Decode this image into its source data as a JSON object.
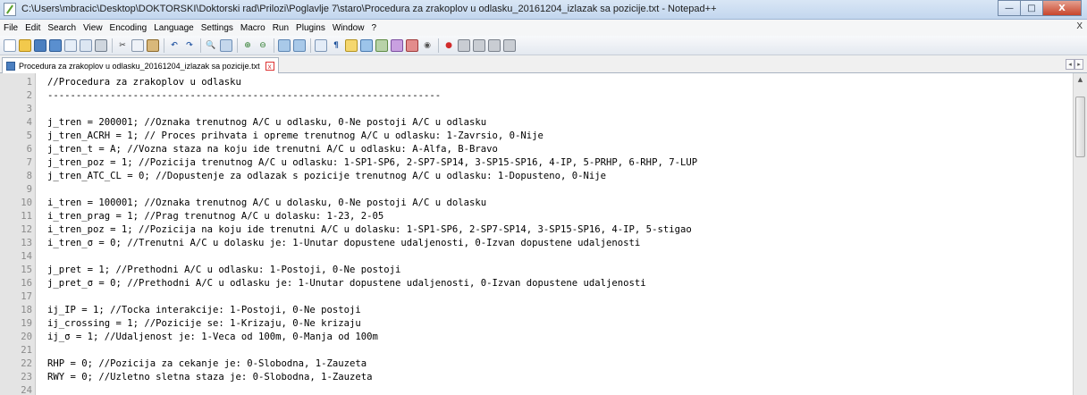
{
  "window": {
    "title": "C:\\Users\\mbracic\\Desktop\\DOKTORSKI\\Doktorski rad\\Prilozi\\Poglavlje 7\\staro\\Procedura za zrakoplov u odlasku_20161204_izlazak sa pozicije.txt - Notepad++",
    "minimize": "—",
    "maximize": "□",
    "close": "X"
  },
  "menu": {
    "items": [
      "File",
      "Edit",
      "Search",
      "View",
      "Encoding",
      "Language",
      "Settings",
      "Macro",
      "Run",
      "Plugins",
      "Window",
      "?"
    ],
    "close_doc": "X"
  },
  "toolbar": {
    "icons": [
      "new-file-icon",
      "open-icon",
      "save-icon",
      "save-all-icon",
      "close-icon",
      "close-all-icon",
      "print-icon",
      "cut-icon",
      "copy-icon",
      "paste-icon",
      "undo-icon",
      "redo-icon",
      "find-icon",
      "replace-icon",
      "zoom-in-icon",
      "zoom-out-icon",
      "sync-v-icon",
      "sync-h-icon",
      "word-wrap-icon",
      "show-all-icon",
      "indent-guide-icon",
      "doc-map-icon",
      "function-list-icon",
      "folder-workspace-icon",
      "monitor-icon",
      "record-macro-icon",
      "stop-macro-icon",
      "play-macro-icon",
      "play-multi-icon",
      "save-macro-icon"
    ]
  },
  "tab": {
    "label": "Procedura za zrakoplov u odlasku_20161204_izlazak sa pozicije.txt",
    "close": "x"
  },
  "editor": {
    "lines": [
      {
        "n": "1",
        "text": "//Procedura za zrakoplov u odlasku"
      },
      {
        "n": "2",
        "text": "---------------------------------------------------------------------"
      },
      {
        "n": "3",
        "text": ""
      },
      {
        "n": "4",
        "text": "j_tren = 200001; //Oznaka trenutnog A/C u odlasku, 0-Ne postoji A/C u odlasku"
      },
      {
        "n": "5",
        "text": "j_tren_ACRH = 1; // Proces prihvata i opreme trenutnog A/C u odlasku: 1-Zavrsio, 0-Nije"
      },
      {
        "n": "6",
        "text": "j_tren_t = A; //Vozna staza na koju ide trenutni A/C u odlasku: A-Alfa, B-Bravo"
      },
      {
        "n": "7",
        "text": "j_tren_poz = 1; //Pozicija trenutnog A/C u odlasku: 1-SP1-SP6, 2-SP7-SP14, 3-SP15-SP16, 4-IP, 5-PRHP, 6-RHP, 7-LUP"
      },
      {
        "n": "8",
        "text": "j_tren_ATC_CL = 0; //Dopustenje za odlazak s pozicije trenutnog A/C u odlasku: 1-Dopusteno, 0-Nije"
      },
      {
        "n": "9",
        "text": ""
      },
      {
        "n": "10",
        "text": "i_tren = 100001; //Oznaka trenutnog A/C u dolasku, 0-Ne postoji A/C u dolasku"
      },
      {
        "n": "11",
        "text": "i_tren_prag = 1; //Prag trenutnog A/C u dolasku: 1-23, 2-05"
      },
      {
        "n": "12",
        "text": "i_tren_poz = 1; //Pozicija na koju ide trenutni A/C u dolasku: 1-SP1-SP6, 2-SP7-SP14, 3-SP15-SP16, 4-IP, 5-stigao"
      },
      {
        "n": "13",
        "text": "i_tren_σ = 0; //Trenutni A/C u dolasku je: 1-Unutar dopustene udaljenosti, 0-Izvan dopustene udaljenosti"
      },
      {
        "n": "14",
        "text": ""
      },
      {
        "n": "15",
        "text": "j_pret = 1; //Prethodni A/C u odlasku: 1-Postoji, 0-Ne postoji"
      },
      {
        "n": "16",
        "text": "j_pret_σ = 0; //Prethodni A/C u odlasku je: 1-Unutar dopustene udaljenosti, 0-Izvan dopustene udaljenosti"
      },
      {
        "n": "17",
        "text": ""
      },
      {
        "n": "18",
        "text": "ij_IP = 1; //Tocka interakcije: 1-Postoji, 0-Ne postoji"
      },
      {
        "n": "19",
        "text": "ij_crossing = 1; //Pozicije se: 1-Krizaju, 0-Ne krizaju"
      },
      {
        "n": "20",
        "text": "ij_σ = 1; //Udaljenost je: 1-Veca od 100m, 0-Manja od 100m"
      },
      {
        "n": "21",
        "text": ""
      },
      {
        "n": "22",
        "text": "RHP = 0; //Pozicija za cekanje je: 0-Slobodna, 1-Zauzeta"
      },
      {
        "n": "23",
        "text": "RWY = 0; //Uzletno sletna staza je: 0-Slobodna, 1-Zauzeta"
      },
      {
        "n": "24",
        "text": ""
      }
    ]
  }
}
